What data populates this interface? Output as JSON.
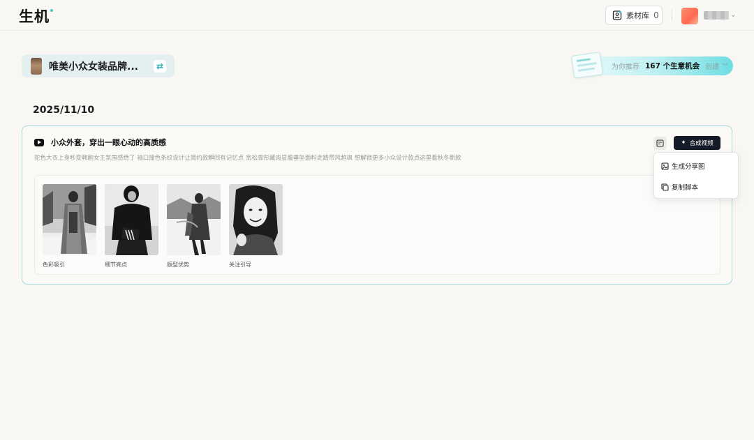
{
  "header": {
    "logo_text": "生机",
    "assets_label": "素材库",
    "assets_count": "0"
  },
  "brand": {
    "name": "唯美小众女装品牌..."
  },
  "recommend": {
    "label": "为你推荐",
    "count_text": "167 个生意机会",
    "action": "创建"
  },
  "date": "2025/11/10",
  "card": {
    "title": "小众外套，穿出一眼心动的高质感",
    "description": "驼色大衣上身秒变韩剧女主氛围感绝了 袖口撞色条纹设计让简约款瞬间有记忆点 宽松廓形藏肉显瘦垂坠面料走路带风超飒 想解锁更多小众设计款点这里看秋冬新款",
    "synth_button": "合成视频",
    "shots": [
      {
        "label": "色彩吸引"
      },
      {
        "label": "细节亮点"
      },
      {
        "label": "版型优势"
      },
      {
        "label": "关注引导"
      }
    ]
  },
  "menu": {
    "items": [
      "生成分享图",
      "复制脚本"
    ]
  },
  "colors": {
    "accent": "#3ecbcf",
    "card_border": "#9fd8d9",
    "primary_button": "#141a26"
  }
}
